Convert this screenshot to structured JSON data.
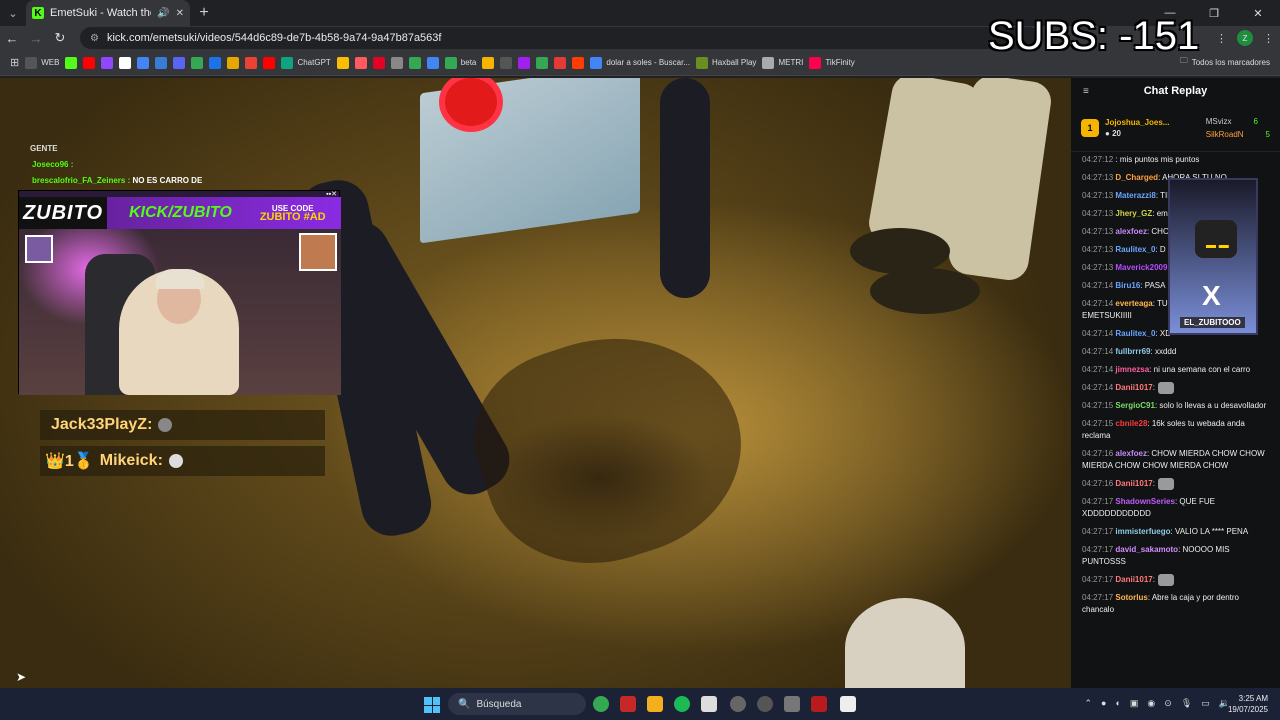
{
  "browser": {
    "tab_title": "EmetSuki - Watch the VOD on",
    "url": "kick.com/emetsuki/videos/544d6c89-de7b-4b58-9a74-9a47b87a563f",
    "profile_initial": "z",
    "bookmarks": [
      {
        "label": "WEB",
        "color": "#555"
      },
      {
        "label": "",
        "color": "#53fc18"
      },
      {
        "label": "",
        "color": "#ff0000"
      },
      {
        "label": "",
        "color": "#9146ff"
      },
      {
        "label": "",
        "color": "#fff"
      },
      {
        "label": "",
        "color": "#4285f4"
      },
      {
        "label": "",
        "color": "#3a7bd5"
      },
      {
        "label": "",
        "color": "#5865f2"
      },
      {
        "label": "",
        "color": "#34a853"
      },
      {
        "label": "",
        "color": "#1a73e8"
      },
      {
        "label": "",
        "color": "#e6a700"
      },
      {
        "label": "",
        "color": "#ea4335"
      },
      {
        "label": "",
        "color": "#ff0000"
      },
      {
        "label": "ChatGPT",
        "color": "#10a37f"
      },
      {
        "label": "",
        "color": "#fbbc05"
      },
      {
        "label": "",
        "color": "#ff5a5f"
      },
      {
        "label": "",
        "color": "#e60023"
      },
      {
        "label": "",
        "color": "#888"
      },
      {
        "label": "",
        "color": "#34a853"
      },
      {
        "label": "",
        "color": "#4285f4"
      },
      {
        "label": "beta",
        "color": "#34a853"
      },
      {
        "label": "",
        "color": "#f5b400"
      },
      {
        "label": "",
        "color": "#555"
      },
      {
        "label": "",
        "color": "#a020f0"
      },
      {
        "label": "",
        "color": "#34a853"
      },
      {
        "label": "",
        "color": "#e53935"
      },
      {
        "label": "",
        "color": "#ff3d00"
      },
      {
        "label": "dolar a soles - Buscar...",
        "color": "#4285f4"
      },
      {
        "label": "Haxball Play",
        "color": "#6b8e23"
      },
      {
        "label": "METRI",
        "color": "#aaa"
      },
      {
        "label": "TikFinity",
        "color": "#ff0050"
      }
    ],
    "bookmarks_folder": "Todos los marcadores"
  },
  "overlay": {
    "subs_text": "SUBS: -151",
    "gente_label": "GENTE",
    "stream_chat": [
      {
        "user": "Joseco96 :",
        "msg": ""
      },
      {
        "user": "brescalofrio_FA_Zeiners :",
        "msg": "NO ES CARRO DE"
      }
    ],
    "pip": {
      "logo": "ZUBITO",
      "kick_text": "KICK/ZUBITO",
      "code_line1": "USE CODE",
      "code_line2": "ZUBITO #AD"
    },
    "alerts": [
      {
        "user": "Jack33PlayZ:",
        "prefix": ""
      },
      {
        "user": "Mikeick:",
        "prefix": "👑1🥇"
      }
    ]
  },
  "chat": {
    "title": "Chat Replay",
    "leaderboard": {
      "top_user": "Jojoshua_Joes...",
      "top_points": "20",
      "second_user": "MSvizx",
      "second_points": "6",
      "third_user": "SilkRoadN",
      "third_points": "5"
    },
    "messages": [
      {
        "time": "04:27:12",
        "user": "",
        "color": "#ff4d4d",
        "text": ": mis puntos mis puntos"
      },
      {
        "time": "04:27:13",
        "user": "D_Charged",
        "color": "#ff9f40",
        "text": ": AHORA SI TU NO"
      },
      {
        "time": "04:27:13",
        "user": "Materazzi8",
        "color": "#6aa6ff",
        "text": ": TIENE",
        "emote": true
      },
      {
        "time": "04:27:13",
        "user": "Jhery_GZ",
        "color": "#cfd34a",
        "text": ": em"
      },
      {
        "time": "04:27:13",
        "user": "alexfoez",
        "color": "#c58af9",
        "text": ": CHOW MIERDA CHOW"
      },
      {
        "time": "04:27:13",
        "user": "Raulitex_0",
        "color": "#6aa6ff",
        "text": ": D"
      },
      {
        "time": "04:27:13",
        "user": "Maverick2009",
        "color": "#b44cff",
        "text": ""
      },
      {
        "time": "04:27:14",
        "user": "Biru16",
        "color": "#6aa6ff",
        "text": ": PASA"
      },
      {
        "time": "04:27:14",
        "user": "everteaga",
        "color": "#ffb74d",
        "text": ": TU SI DAS SHOW EMETSUKIIIII"
      },
      {
        "time": "04:27:14",
        "user": "Raulitex_0",
        "color": "#6aa6ff",
        "text": ": XD"
      },
      {
        "time": "04:27:14",
        "user": "fullbrrr69",
        "color": "#8ecae6",
        "text": ": xxddd"
      },
      {
        "time": "04:27:14",
        "user": "jimnezsa",
        "color": "#ff5fa2",
        "text": ": ni una semana con el carro"
      },
      {
        "time": "04:27:14",
        "user": "Danii1017",
        "color": "#ff7a7a",
        "text": ":",
        "emote": true
      },
      {
        "time": "04:27:15",
        "user": "SergioC91",
        "color": "#7bdc65",
        "text": ": solo lo llevas a u desavollador"
      },
      {
        "time": "04:27:15",
        "user": "cbnile28",
        "color": "#ff3b3b",
        "text": ": 16k soles tu webada anda reclama"
      },
      {
        "time": "04:27:16",
        "user": "alexfoez",
        "color": "#c58af9",
        "text": ": CHOW MIERDA CHOW CHOW MIERDA CHOW CHOW MIERDA CHOW"
      },
      {
        "time": "04:27:16",
        "user": "Danii1017",
        "color": "#ff7a7a",
        "text": ":",
        "emote": true
      },
      {
        "time": "04:27:17",
        "user": "ShadownSeries",
        "color": "#c15cff",
        "text": ": QUE FUE XDDDDDDDDDDD"
      },
      {
        "time": "04:27:17",
        "user": "immisterfuego",
        "color": "#8ecae6",
        "text": ": VALIO LA **** PENA"
      },
      {
        "time": "04:27:17",
        "user": "david_sakamoto",
        "color": "#d28cff",
        "text": ": NOOOO MIS PUNTOSSS"
      },
      {
        "time": "04:27:17",
        "user": "Danii1017",
        "color": "#ff7a7a",
        "text": ":",
        "emote": true
      },
      {
        "time": "04:27:17",
        "user": "Sotorlus",
        "color": "#ffb74d",
        "text": ": Abre la caja y por dentro chancalo"
      }
    ],
    "x_card_name": "EL_ZUBITOOO"
  },
  "taskbar": {
    "search_placeholder": "Búsqueda",
    "time": "3:25 AM",
    "date": "19/07/2025"
  }
}
